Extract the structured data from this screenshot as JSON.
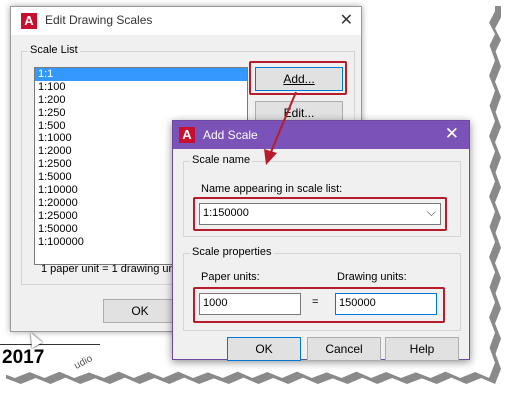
{
  "background": {
    "year": "2017",
    "diagonal_text": "udio"
  },
  "edit_scales": {
    "title": "Edit Drawing Scales",
    "group_label": "Scale List",
    "items": [
      "1:1",
      "1:100",
      "1:200",
      "1:250",
      "1:500",
      "1:1000",
      "1:2000",
      "1:2500",
      "1:5000",
      "1:10000",
      "1:20000",
      "1:25000",
      "1:50000",
      "1:100000"
    ],
    "selected_index": 0,
    "add_label": "Add...",
    "edit_label": "Edit...",
    "footer": "1 paper unit = 1 drawing unit",
    "ok_label": "OK"
  },
  "add_scale": {
    "title": "Add Scale",
    "scale_name_group": "Scale name",
    "name_label": "Name appearing in scale list:",
    "name_value": "1:150000",
    "props_group": "Scale properties",
    "paper_label": "Paper units:",
    "drawing_label": "Drawing units:",
    "paper_value": "1000",
    "equals": "=",
    "drawing_value": "150000",
    "ok_label": "OK",
    "cancel_label": "Cancel",
    "help_label": "Help"
  },
  "colors": {
    "highlight": "#b71c2b",
    "add_scale_titlebar": "#7b52b8",
    "selection": "#3399ff",
    "autocad_logo": "#c8102e"
  },
  "icons": [
    "autocad-logo-icon",
    "close-icon",
    "chevron-down-icon",
    "mouse-cursor-icon",
    "callout-arrow-icon"
  ]
}
